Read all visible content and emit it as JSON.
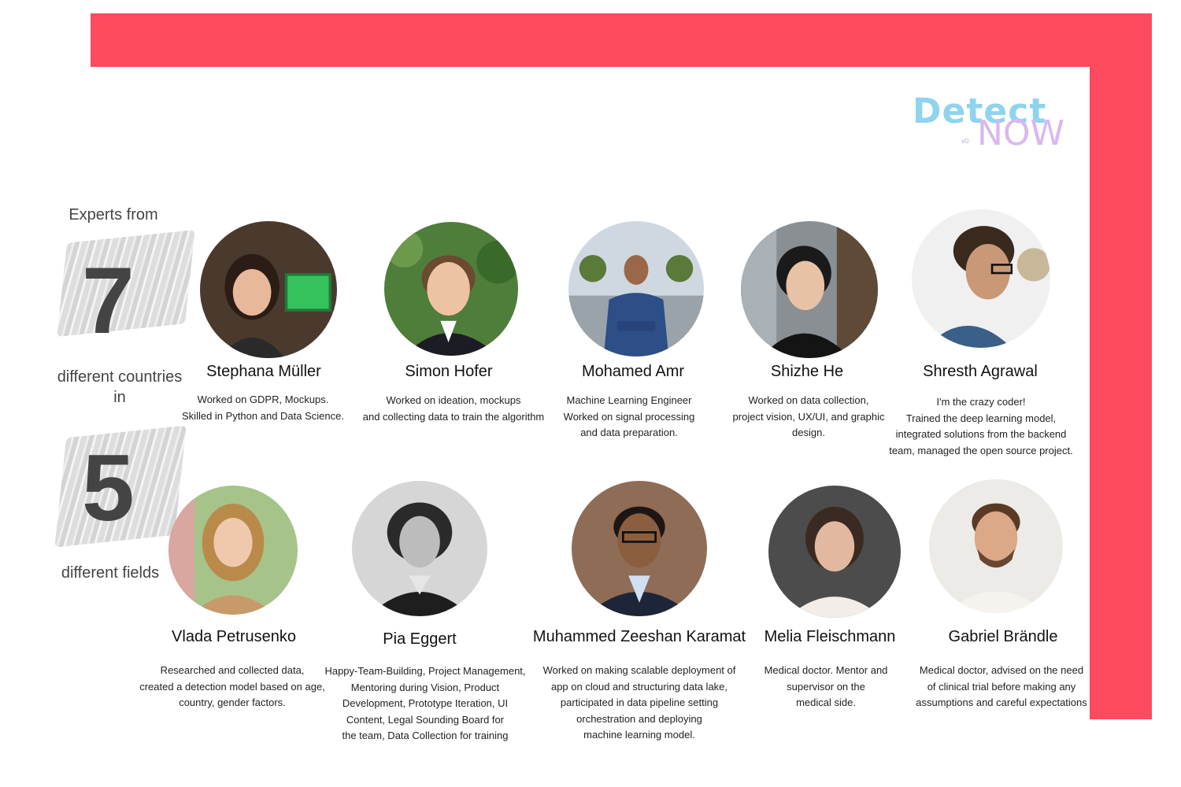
{
  "colors": {
    "accent": "#fd4a5f",
    "logo_primary": "#8fd3ee",
    "logo_secondary": "#d9b8ef"
  },
  "logo": {
    "word1": "Detect",
    "word2": "NOW",
    "version": "v0"
  },
  "stats": {
    "experts_from": "Experts from",
    "countries_number": "7",
    "countries_label": "different countries",
    "in_label": "in",
    "fields_number": "5",
    "fields_label": "different fields"
  },
  "team": [
    {
      "name": "Stephana Müller",
      "lines": [
        "Worked on GDPR, Mockups.",
        "Skilled in Python and Data Science."
      ]
    },
    {
      "name": "Simon Hofer",
      "lines": [
        "Worked on ideation, mockups",
        "and collecting data to train the algorithm"
      ]
    },
    {
      "name": "Mohamed Amr",
      "lines": [
        "Machine Learning Engineer",
        "Worked on signal processing",
        "and data preparation."
      ]
    },
    {
      "name": "Shizhe He",
      "lines": [
        "Worked on data collection,",
        "project vision, UX/UI, and graphic",
        "design."
      ]
    },
    {
      "name": "Shresth Agrawal",
      "lines": [
        "I'm the crazy coder!",
        "Trained the deep learning model,",
        "integrated solutions from the backend",
        "team, managed the open source project."
      ]
    },
    {
      "name": "Vlada Petrusenko",
      "lines": [
        "Researched and collected data,",
        "created a detection model based on age,",
        "country, gender factors."
      ]
    },
    {
      "name": "Pia Eggert",
      "lines": [
        "Happy-Team-Building, Project Management,",
        "Mentoring during Vision, Product",
        "Development, Prototype Iteration, UI",
        "Content, Legal Sounding Board for",
        "the team, Data Collection  for training"
      ]
    },
    {
      "name": "Muhammed Zeeshan Karamat",
      "lines": [
        "Worked on making scalable deployment of",
        "app on cloud and structuring data lake,",
        "participated in data pipeline setting",
        "orchestration and deploying",
        "machine learning model."
      ]
    },
    {
      "name": "Melia Fleischmann",
      "lines": [
        "Medical doctor. Mentor and",
        "supervisor on the",
        "medical side."
      ]
    },
    {
      "name": "Gabriel Brändle",
      "lines": [
        "Medical doctor, advised on the need",
        "of clinical trial before making any",
        "assumptions and careful expectations"
      ]
    }
  ]
}
